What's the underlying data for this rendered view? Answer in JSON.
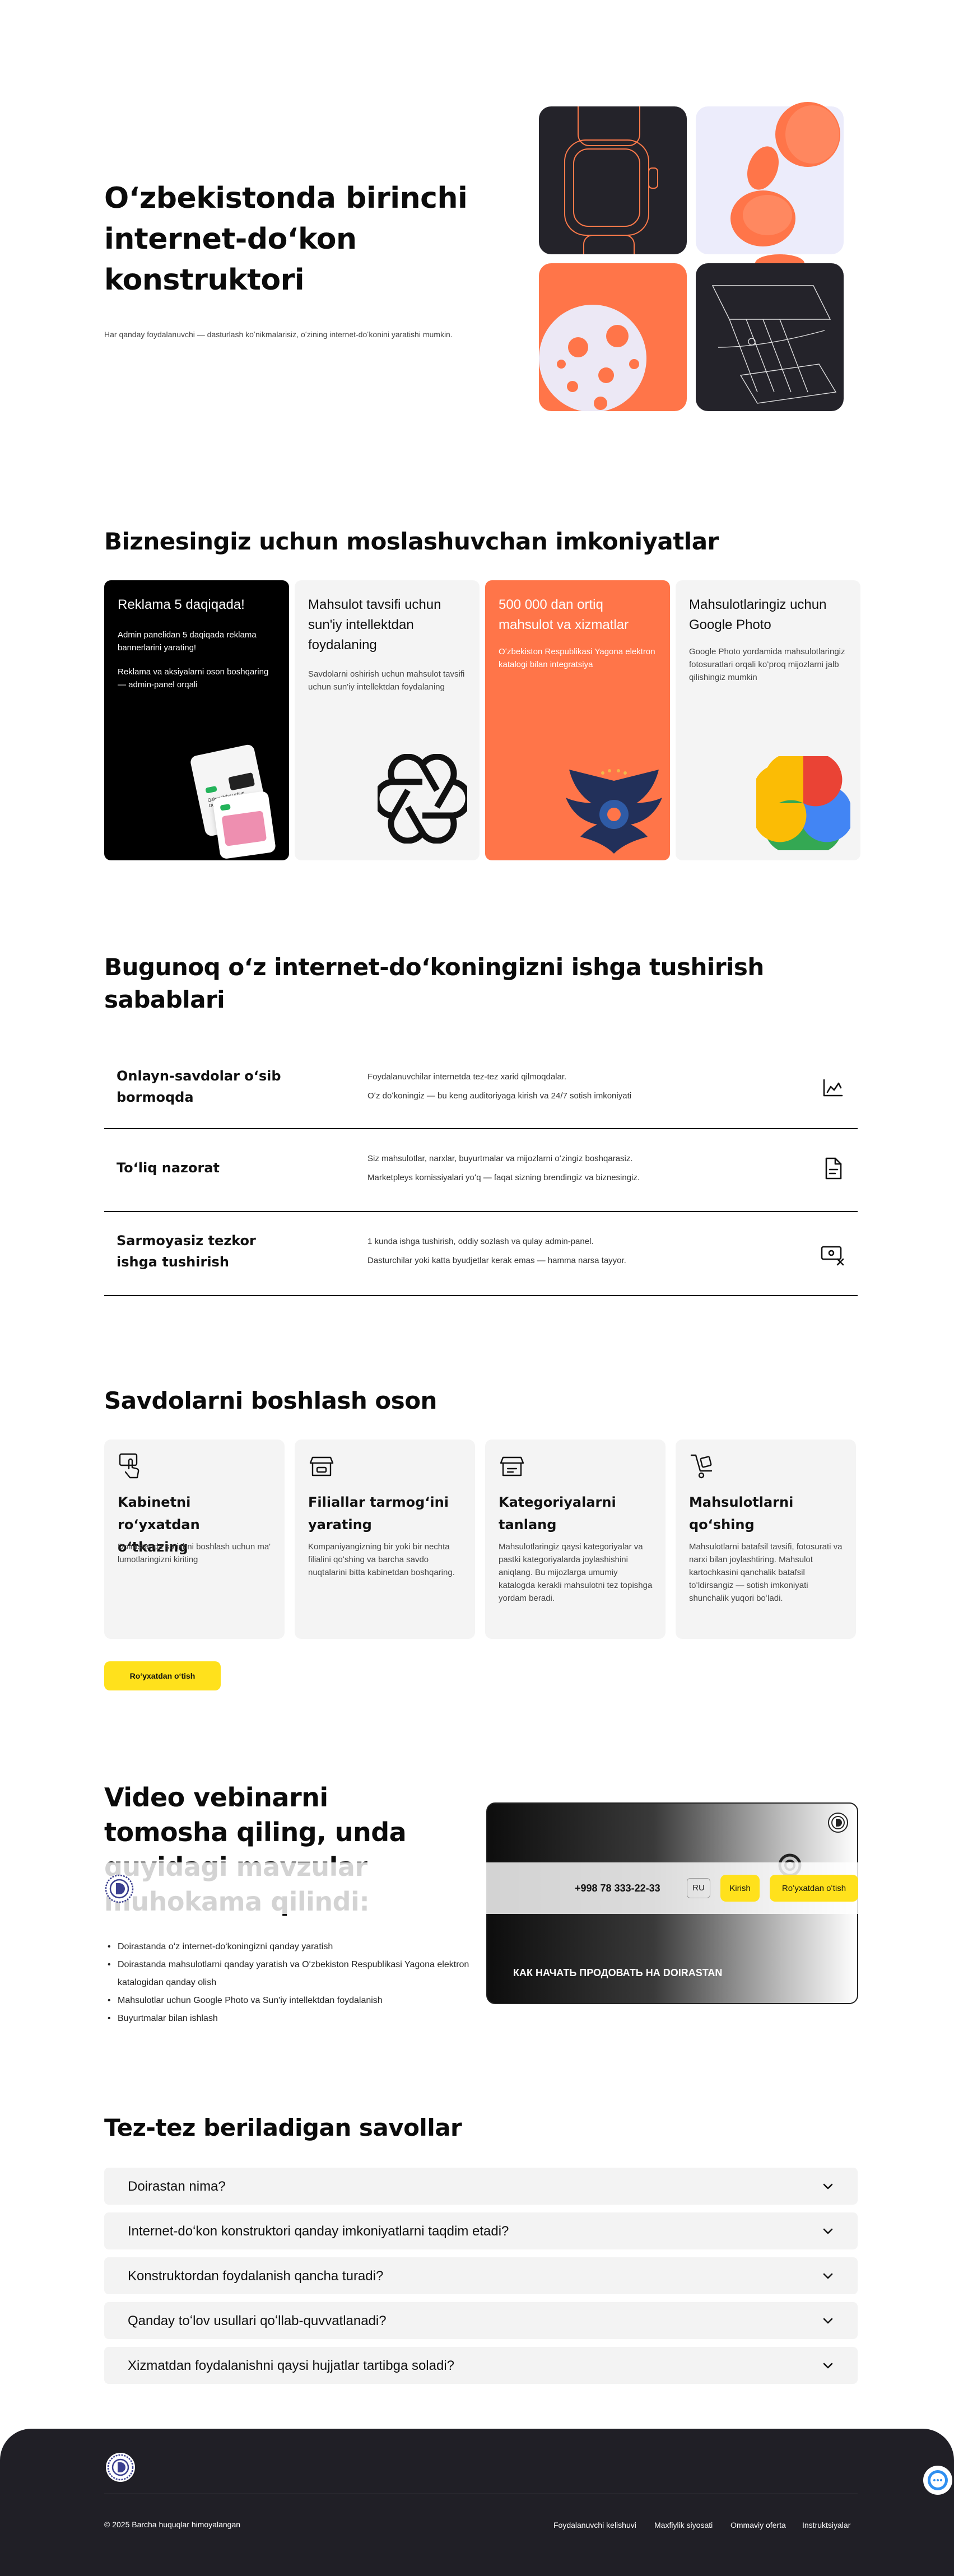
{
  "hero": {
    "title": "Oʻzbekistonda birinchi internet-doʻkon konstruktori",
    "subtitle": "Har qanday foydalanuvchi — dasturlash koʻnikmalarisiz, oʻzining internet-doʻkonini yaratishi mumkin."
  },
  "features": {
    "title": "Biznesingiz uchun moslashuvchan imkoniyatlar",
    "cards": [
      {
        "title": "Reklama 5 daqiqada!",
        "desc1": "Admin panelidan 5 daqiqada reklama bannerlarini yarating!",
        "desc2": "Reklama va aksiyalarni oson boshqaring — admin-panel orqali",
        "mock_text": "Qahvachilar uchun Doirasta",
        "colors": {
          "bg": "#000000",
          "text": "#ffffff"
        }
      },
      {
        "title": "Mahsulot tavsifi uchun sun'iy intellektdan foydalaning",
        "desc": "Savdolarni oshirish uchun mahsulot tavsifi uchun sun'iy intellektdan foydalaning",
        "icon": "openai-icon",
        "colors": {
          "bg": "#f4f4f4",
          "text": "#111111"
        }
      },
      {
        "title": "500 000 dan ortiq mahsulot va xizmatlar",
        "desc": "Oʻzbekiston Respublikasi Yagona elektron katalogi bilan integratsiya",
        "icon": "eagle-emblem-icon",
        "colors": {
          "bg": "#ff7549",
          "text": "#ffffff"
        }
      },
      {
        "title": "Mahsulotlaringiz uchun Google Photo",
        "desc": "Google Photo yordamida mahsulotlaringiz fotosuratlari orqali koʻproq mijozlarni jalb qilishingiz mumkin",
        "icon": "google-photos-icon",
        "colors": {
          "bg": "#f4f4f4",
          "text": "#111111"
        }
      }
    ]
  },
  "reasons": {
    "title": "Bugunoq oʻz internet-doʻkoningizni ishga tushirish sabablari",
    "rows": [
      {
        "title": "Onlayn-savdolar oʻsib bormoqda",
        "line1": "Foydalanuvchilar internetda tez-tez xarid qilmoqdalar.",
        "line2": "Oʻz doʻkoningiz — bu keng auditoriyaga kirish va 24/7 sotish imkoniyati",
        "icon": "chart-growth-icon"
      },
      {
        "title": "Toʻliq nazorat",
        "line1": "Siz mahsulotlar, narxlar, buyurtmalar va mijozlarni oʻzingiz boshqarasiz.",
        "line2": "Marketpleys komissiyalari yoʻq — faqat sizning brendingiz va biznesingiz.",
        "icon": "document-icon"
      },
      {
        "title": "Sarmoyasiz tezkor ishga tushirish",
        "line1": "1 kunda ishga tushirish, oddiy sozlash va qulay admin-panel.",
        "line2": "Dasturchilar yoki katta byudjetlar kerak emas — hamma narsa tayyor.",
        "icon": "money-cross-icon"
      }
    ]
  },
  "steps": {
    "title": "Savdolarni boshlash oson",
    "items": [
      {
        "title": "Kabinetni roʻyxatdan oʻtkazing",
        "desc": "Doirastanda sotishni boshlash uchun ma' lumotlaringizni kiriting",
        "icon": "hand-pointer-icon"
      },
      {
        "title": "Filiallar tarmogʻini yarating",
        "desc": "Kompaniyangizning bir yoki bir nechta filialini qoʻshing va barcha savdo nuqtalarini bitta kabinetdan boshqaring.",
        "icon": "store-icon"
      },
      {
        "title": "Kategoriyalarni tanlang",
        "desc": "Mahsulotlaringiz qaysi kategoriyalar va pastki kategoriyalarda joylashishini aniqlang. Bu mijozlarga umumiy katalogda kerakli mahsulotni tez topishga yordam beradi.",
        "icon": "category-store-icon"
      },
      {
        "title": "Mahsulotlarni qoʻshing",
        "desc": "Mahsulotlarni batafsil tavsifi, fotosurati va narxi bilan joylashtiring. Mahsulot kartochkasini qanchalik batafsil toʻldirsangiz — sotish imkoniyati shunchalik yuqori boʻladi.",
        "icon": "trolley-icon"
      }
    ],
    "button": "Roʻyxatdan oʻtish"
  },
  "webinar": {
    "title": "Video vebinarni tomosha qiling, unda quyidagi mavzular muhokama qilindi:",
    "topics": [
      "Doirastanda oʻz internet-doʻkoningizni qanday yaratish",
      "Doirastanda mahsulotlarni qanday yaratish va Oʻzbekiston Respublikasi Yagona elektron katalogidan qanday olish",
      "Mahsulotlar uchun Google Photo va Sun'iy intellektdan foydalanish",
      "Buyurtmalar bilan ishlash"
    ],
    "video_caption": "КАК НАЧАТЬ ПРОДОВАТЬ НА",
    "video_brand": "DOIRASTAN"
  },
  "header": {
    "phone": "+998 78 333-22-33",
    "lang": "RU",
    "login": "Kirish",
    "register": "Roʻyxatdan oʻtish"
  },
  "faq": {
    "title": "Tez-tez beriladigan savollar",
    "items": [
      "Doirastan nima?",
      "Internet-doʻkon konstruktori qanday imkoniyatlarni taqdim etadi?",
      "Konstruktordan foydalanish qancha turadi?",
      "Qanday toʻlov usullari qoʻllab-quvvatlanadi?",
      "Xizmatdan foydalanishni qaysi hujjatlar tartibga soladi?"
    ]
  },
  "footer": {
    "copyright": "© 2025 Barcha huquqlar himoyalangan",
    "links": [
      "Foydalanuvchi kelishuvi",
      "Maxfiylik siyosati",
      "Ommaviy oferta",
      "Instruktsiyalar"
    ]
  },
  "colors": {
    "accent": "#ffe11c",
    "orange": "#ff7549",
    "dark": "#201f26",
    "lavender": "#ececfb"
  }
}
